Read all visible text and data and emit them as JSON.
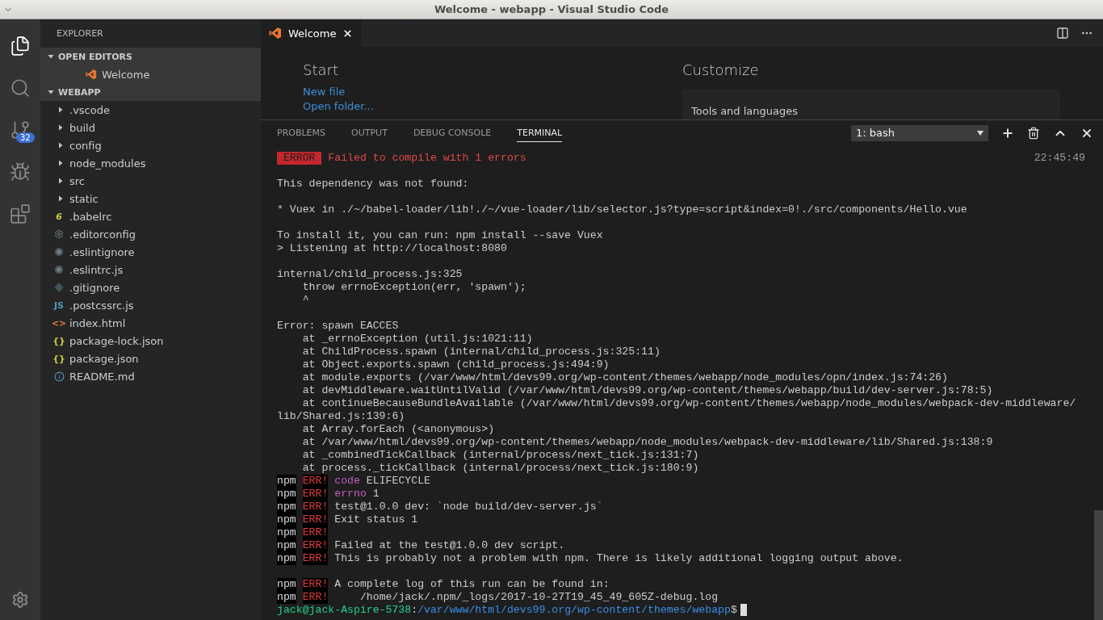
{
  "window": {
    "title": "Welcome - webapp - Visual Studio Code"
  },
  "activity_bar": [
    {
      "kind": "files",
      "selected": true
    },
    {
      "kind": "search",
      "selected": false
    },
    {
      "kind": "scm",
      "selected": false,
      "badge": "32"
    },
    {
      "kind": "debug",
      "selected": false
    },
    {
      "kind": "extensions",
      "selected": false
    }
  ],
  "sidebar": {
    "title": "EXPLORER",
    "open_editors": {
      "label": "OPEN EDITORS",
      "expanded": true,
      "items": [
        {
          "name": "Welcome"
        }
      ]
    },
    "folder": {
      "label": "WEBAPP",
      "expanded": true,
      "items": [
        {
          "name": ".vscode",
          "kind": "folder"
        },
        {
          "name": "build",
          "kind": "folder"
        },
        {
          "name": "config",
          "kind": "folder"
        },
        {
          "name": "node_modules",
          "kind": "folder"
        },
        {
          "name": "src",
          "kind": "folder"
        },
        {
          "name": "static",
          "kind": "folder"
        },
        {
          "name": ".babelrc",
          "kind": "babel",
          "glyph": "6"
        },
        {
          "name": ".editorconfig",
          "kind": "gear"
        },
        {
          "name": ".eslintignore",
          "kind": "eslint"
        },
        {
          "name": ".eslintrc.js",
          "kind": "eslint"
        },
        {
          "name": ".gitignore",
          "kind": "git"
        },
        {
          "name": ".postcssrc.js",
          "kind": "js",
          "glyph": "JS"
        },
        {
          "name": "index.html",
          "kind": "html",
          "glyph": "<>"
        },
        {
          "name": "package-lock.json",
          "kind": "json",
          "glyph": "{}"
        },
        {
          "name": "package.json",
          "kind": "json",
          "glyph": "{}"
        },
        {
          "name": "README.md",
          "kind": "info"
        }
      ]
    }
  },
  "editor": {
    "tabs": [
      {
        "label": "Welcome",
        "selected": true
      }
    ],
    "welcome": {
      "start_title": "Start",
      "links": [
        "New file",
        "Open folder..."
      ],
      "customize_title": "Customize",
      "card_title": "Tools and languages"
    }
  },
  "panel": {
    "tabs": [
      {
        "label": "PROBLEMS",
        "selected": false
      },
      {
        "label": "OUTPUT",
        "selected": false
      },
      {
        "label": "DEBUG CONSOLE",
        "selected": false
      },
      {
        "label": "TERMINAL",
        "selected": true
      }
    ],
    "terminal_select": "1: bash",
    "time": "22:45:49",
    "lines": [
      {
        "kind": "banner",
        "tag": "ERROR",
        "text": "Failed to compile with 1 errors"
      },
      {
        "kind": "blank"
      },
      {
        "kind": "plain",
        "text": "This dependency was not found:"
      },
      {
        "kind": "blank"
      },
      {
        "kind": "plain",
        "text": "* Vuex in ./~/babel-loader/lib!./~/vue-loader/lib/selector.js?type=script&index=0!./src/components/Hello.vue"
      },
      {
        "kind": "blank"
      },
      {
        "kind": "plain",
        "text": "To install it, you can run: npm install --save Vuex"
      },
      {
        "kind": "plain",
        "text": "> Listening at http://localhost:8080"
      },
      {
        "kind": "blank"
      },
      {
        "kind": "plain",
        "text": "internal/child_process.js:325"
      },
      {
        "kind": "plain",
        "text": "    throw errnoException(err, 'spawn');"
      },
      {
        "kind": "plain",
        "text": "    ^"
      },
      {
        "kind": "blank"
      },
      {
        "kind": "plain",
        "text": "Error: spawn EACCES"
      },
      {
        "kind": "plain",
        "text": "    at _errnoException (util.js:1021:11)"
      },
      {
        "kind": "plain",
        "text": "    at ChildProcess.spawn (internal/child_process.js:325:11)"
      },
      {
        "kind": "plain",
        "text": "    at Object.exports.spawn (child_process.js:494:9)"
      },
      {
        "kind": "plain",
        "text": "    at module.exports (/var/www/html/devs99.org/wp-content/themes/webapp/node_modules/opn/index.js:74:26)"
      },
      {
        "kind": "plain",
        "text": "    at devMiddleware.waitUntilValid (/var/www/html/devs99.org/wp-content/themes/webapp/build/dev-server.js:78:5)"
      },
      {
        "kind": "plain",
        "text": "    at continueBecauseBundleAvailable (/var/www/html/devs99.org/wp-content/themes/webapp/node_modules/webpack-dev-middleware/"
      },
      {
        "kind": "plain",
        "text": "lib/Shared.js:139:6)"
      },
      {
        "kind": "plain",
        "text": "    at Array.forEach (<anonymous>)"
      },
      {
        "kind": "plain",
        "text": "    at /var/www/html/devs99.org/wp-content/themes/webapp/node_modules/webpack-dev-middleware/lib/Shared.js:138:9"
      },
      {
        "kind": "plain",
        "text": "    at _combinedTickCallback (internal/process/next_tick.js:131:7)"
      },
      {
        "kind": "plain",
        "text": "    at process._tickCallback (internal/process/next_tick.js:180:9)"
      },
      {
        "kind": "npm",
        "prefix": "npm",
        "tag": "ERR!",
        "keyword": "code",
        "text": "ELIFECYCLE"
      },
      {
        "kind": "npm",
        "prefix": "npm",
        "tag": "ERR!",
        "keyword": "errno",
        "text": "1"
      },
      {
        "kind": "npm",
        "prefix": "npm",
        "tag": "ERR!",
        "text": "test@1.0.0 dev: `node build/dev-server.js`"
      },
      {
        "kind": "npm",
        "prefix": "npm",
        "tag": "ERR!",
        "text": "Exit status 1"
      },
      {
        "kind": "npm",
        "prefix": "npm",
        "tag": "ERR!"
      },
      {
        "kind": "npm",
        "prefix": "npm",
        "tag": "ERR!",
        "text": "Failed at the test@1.0.0 dev script."
      },
      {
        "kind": "npm",
        "prefix": "npm",
        "tag": "ERR!",
        "text": "This is probably not a problem with npm. There is likely additional logging output above."
      },
      {
        "kind": "blank"
      },
      {
        "kind": "npm",
        "prefix": "npm",
        "tag": "ERR!",
        "text": "A complete log of this run can be found in:"
      },
      {
        "kind": "npm",
        "prefix": "npm",
        "tag": "ERR!",
        "text": "    /home/jack/.npm/_logs/2017-10-27T19_45_49_605Z-debug.log"
      },
      {
        "kind": "prompt",
        "user": "jack@jack-Aspire-5738",
        "sep": ":",
        "path": "/var/www/html/devs99.org/wp-content/themes/webapp",
        "sign": "$"
      }
    ]
  }
}
